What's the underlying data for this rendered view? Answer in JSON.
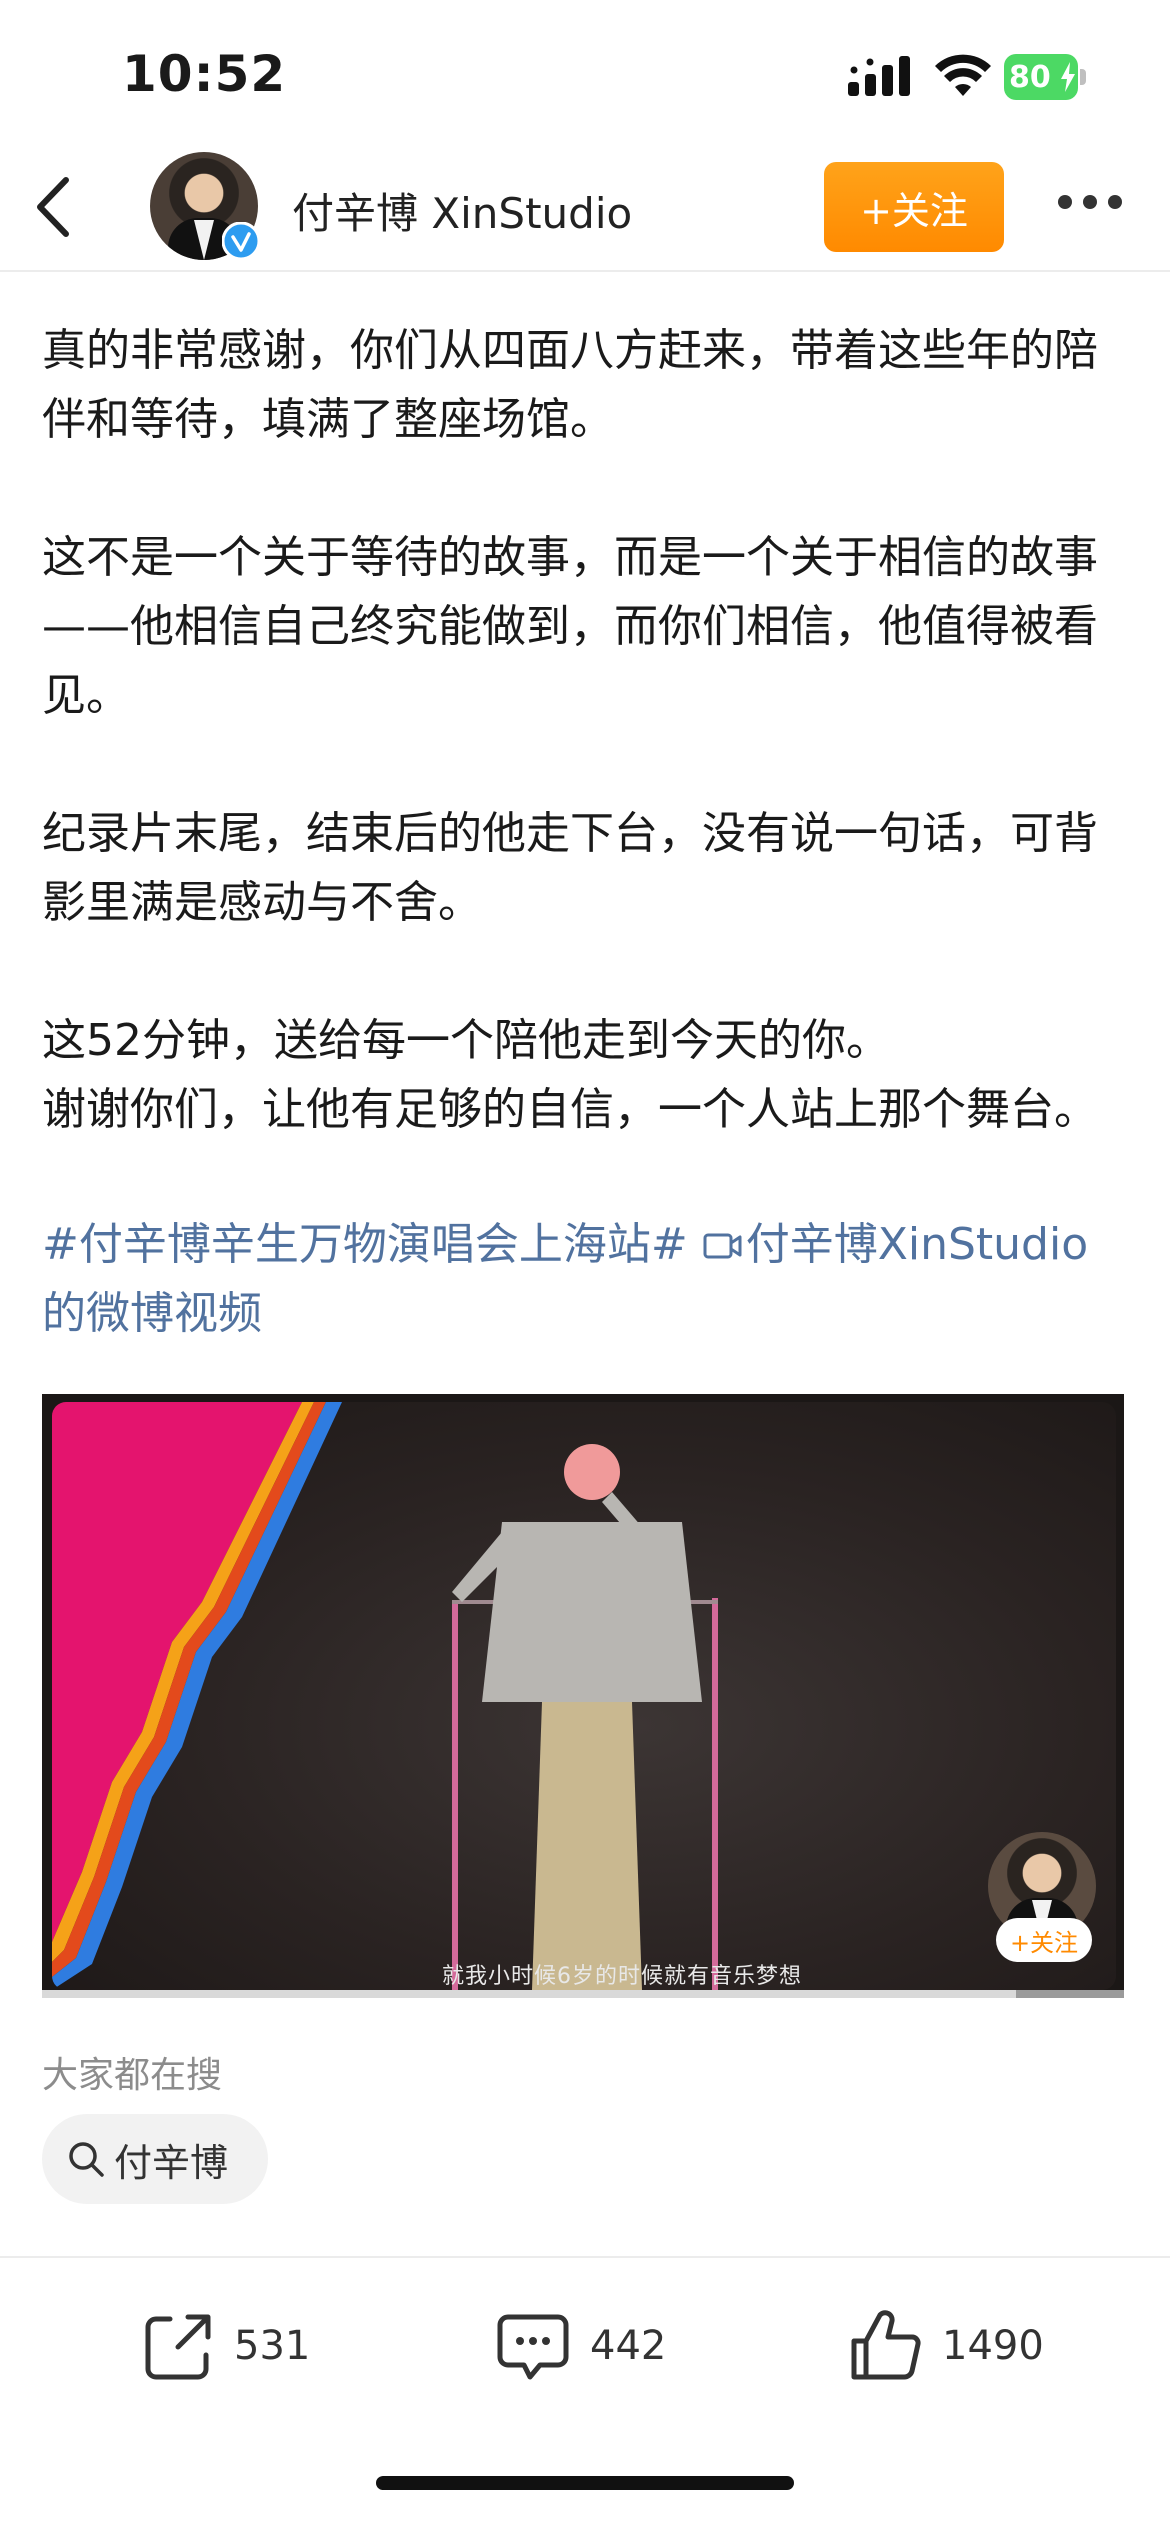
{
  "status_bar": {
    "time": "10:52",
    "battery": "80"
  },
  "header": {
    "user_name": "付辛博 XinStudio",
    "follow_label": "+关注"
  },
  "post": {
    "paragraphs": [
      "真的非常感谢，你们从四面八方赶来，带着这些年的陪伴和等待，填满了整座场馆。",
      "这不是一个关于等待的故事，而是一个关于相信的故事——他相信自己终究能做到，而你们相信，他值得被看见。",
      "纪录片末尾，结束后的他走下台，没有说一句话，可背影里满是感动与不舍。",
      "这52分钟，送给每一个陪他走到今天的你。",
      "谢谢你们，让他有足够的自信，一个人站上那个舞台。"
    ],
    "hashtag": "#付辛博辛生万物演唱会上海站#",
    "video_link": "付辛博XinStudio的微博视频"
  },
  "video": {
    "subtitle": "就我小时候6岁的时候就有音乐梦想",
    "follow_label": "+关注",
    "progress": 0.9
  },
  "search": {
    "label": "大家都在搜",
    "chip": "付辛博"
  },
  "actions": {
    "share_count": "531",
    "comment_count": "442",
    "like_count": "1490"
  },
  "colors": {
    "accent": "#ff8a00",
    "link": "#51729f"
  }
}
